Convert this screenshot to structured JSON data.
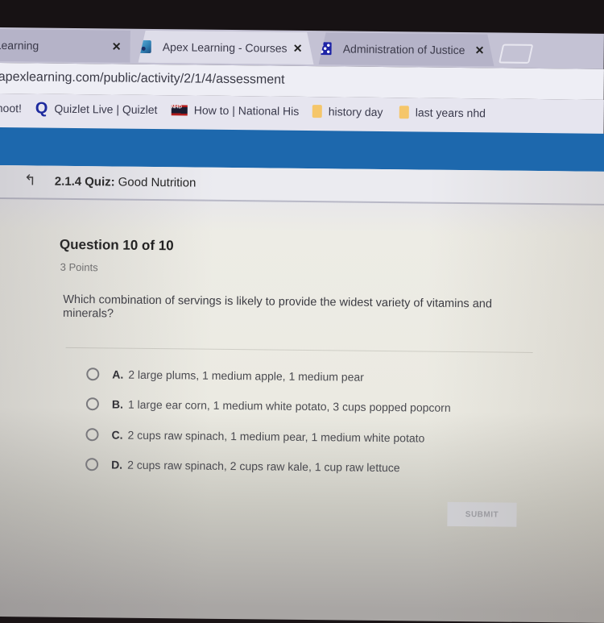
{
  "browser": {
    "tabs": [
      {
        "title": "Learning",
        "icon": "apex-favicon",
        "active": false
      },
      {
        "title": "Apex Learning - Courses",
        "icon": "apex-favicon",
        "active": true
      },
      {
        "title": "Administration of Justice",
        "icon": "justice-favicon",
        "active": false
      }
    ],
    "close_glyph": "✕",
    "url": "apexlearning.com/public/activity/2/1/4/assessment",
    "bookmarks": [
      {
        "label": "hoot!",
        "icon": "none"
      },
      {
        "label": "Quizlet Live | Quizlet",
        "icon": "quizlet-icon",
        "glyph": "Q"
      },
      {
        "label": "How to | National His",
        "icon": "nhd-icon",
        "glyph": "NHD"
      },
      {
        "label": "history day",
        "icon": "folder-icon"
      },
      {
        "label": "last years nhd",
        "icon": "folder-icon"
      }
    ]
  },
  "quiz": {
    "back_glyph": "↰",
    "code": "2.1.4",
    "kind": "Quiz:",
    "name": "Good Nutrition"
  },
  "question": {
    "heading": "Question 10 of 10",
    "points": "3 Points",
    "prompt": "Which combination of servings is likely to provide the widest variety of vitamins and minerals?",
    "choices": [
      {
        "letter": "A.",
        "text": "2 large plums, 1 medium apple, 1 medium pear",
        "selected": false
      },
      {
        "letter": "B.",
        "text": "1 large ear corn, 1 medium white potato, 3 cups popped popcorn",
        "selected": false
      },
      {
        "letter": "C.",
        "text": "2 cups raw spinach, 1 medium pear, 1 medium white potato",
        "selected": false
      },
      {
        "letter": "D.",
        "text": "2 cups raw spinach, 2 cups raw kale, 1 cup raw lettuce",
        "selected": false
      }
    ],
    "submit_label": "SUBMIT",
    "submit_enabled": false
  },
  "colors": {
    "header_blue": "#1d68ad",
    "quizlet_blue": "#1d2a9e",
    "folder_yellow": "#f5c66a"
  }
}
